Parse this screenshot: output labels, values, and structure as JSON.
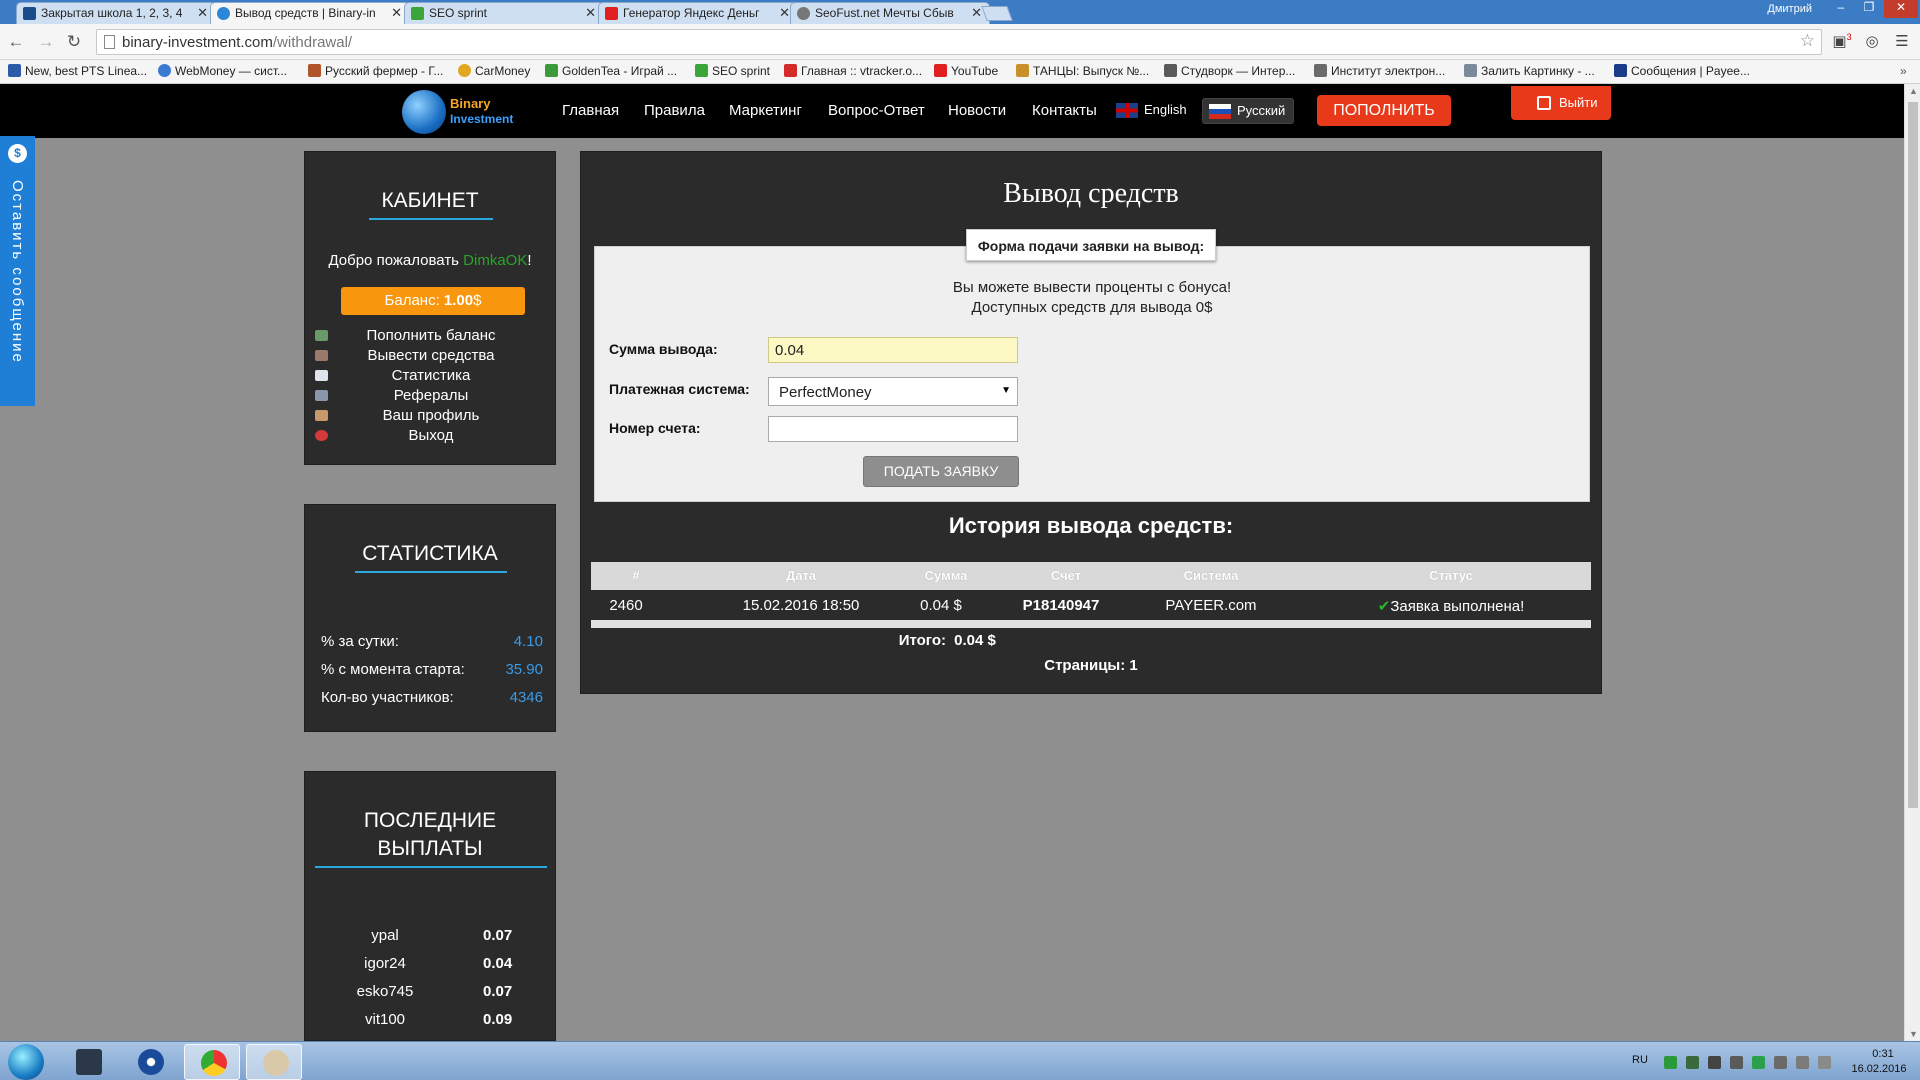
{
  "browser": {
    "tabs": [
      {
        "label": "Закрытая школа 1, 2, 3, 4"
      },
      {
        "label": "Вывод средств | Binary-in"
      },
      {
        "label": "SEO sprint"
      },
      {
        "label": "Генератор Яндекс Деньг"
      },
      {
        "label": "SeoFust.net Мечты Сбыв"
      }
    ],
    "user": "Дмитрий",
    "url_domain": "binary-investment.com",
    "url_path": "/withdrawal/",
    "bookmarks": [
      {
        "label": "New, best PTS Linea..."
      },
      {
        "label": "WebMoney — сист..."
      },
      {
        "label": "Русский фермер - Г..."
      },
      {
        "label": "CarMoney"
      },
      {
        "label": "GoldenTea - Играй ..."
      },
      {
        "label": "SEO sprint"
      },
      {
        "label": "Главная :: vtracker.o..."
      },
      {
        "label": "YouTube"
      },
      {
        "label": "ТАНЦЫ: Выпуск №..."
      },
      {
        "label": "Студворк — Интер..."
      },
      {
        "label": "Институт электрон..."
      },
      {
        "label": "Залить Картинку - ..."
      },
      {
        "label": "Сообщения | Payee..."
      }
    ],
    "extension_badge": "3"
  },
  "site": {
    "logo_line1": "Binary",
    "logo_line2": "Investment",
    "nav": [
      "Главная",
      "Правила",
      "Маркетинг",
      "Вопрос-Ответ",
      "Новости",
      "Контакты"
    ],
    "lang_en": "English",
    "lang_ru": "Русский",
    "topup_label": "ПОПОЛНИТЬ",
    "logout_label": "Выйти"
  },
  "feedback": {
    "label": "Оставить сообщение",
    "icon": "$"
  },
  "cabinet": {
    "title": "КАБИНЕТ",
    "welcome_prefix": "Добро пожаловать ",
    "username": "DimkaOK",
    "welcome_suffix": "!",
    "balance_label": "Баланс: ",
    "balance_value": "1.00",
    "balance_currency": "$",
    "menu": [
      {
        "label": "Пополнить баланс",
        "icon": "wallet-in-icon"
      },
      {
        "label": "Вывести средства",
        "icon": "wallet-out-icon"
      },
      {
        "label": "Статистика",
        "icon": "document-icon"
      },
      {
        "label": "Рефералы",
        "icon": "users-icon"
      },
      {
        "label": "Ваш профиль",
        "icon": "user-icon"
      },
      {
        "label": "Выход",
        "icon": "power-icon"
      }
    ]
  },
  "stats": {
    "title": "СТАТИСТИКА",
    "rows": [
      {
        "label": "% за сутки:",
        "value": "4.10"
      },
      {
        "label": "% с момента старта:",
        "value": "35.90"
      },
      {
        "label": "Кол-во участников:",
        "value": "4346"
      }
    ]
  },
  "payouts": {
    "title_line1": "ПОСЛЕДНИЕ",
    "title_line2": "ВЫПЛАТЫ",
    "rows": [
      {
        "name": "ypal",
        "value": "0.07"
      },
      {
        "name": "igor24",
        "value": "0.04"
      },
      {
        "name": "esko745",
        "value": "0.07"
      },
      {
        "name": "vit100",
        "value": "0.09"
      }
    ]
  },
  "withdraw": {
    "title": "Вывод средств",
    "form_legend": "Форма подачи заявки на вывод:",
    "info1": "Вы можете вывести проценты с бонуса!",
    "info2": "Доступных средств для вывода 0$",
    "amount_label": "Сумма вывода:",
    "amount_value": "0.04",
    "system_label": "Платежная система:",
    "system_value": "PerfectMoney",
    "account_label": "Номер счета:",
    "account_value": "",
    "submit_label": "ПОДАТЬ ЗАЯВКУ"
  },
  "history": {
    "title": "История вывода средств:",
    "columns": [
      "#",
      "Дата",
      "Сумма",
      "Счет",
      "Система",
      "Статус"
    ],
    "rows": [
      {
        "id": "2460",
        "date": "15.02.2016 18:50",
        "amount": "0.04 $",
        "account": "P18140947",
        "system": "PAYEER.com",
        "status": "Заявка выполнена!"
      }
    ],
    "total_label": "Итого:",
    "total_value": "0.04 $",
    "pages_label": "Страницы: ",
    "pages_value": "1"
  },
  "taskbar": {
    "lang": "RU",
    "time": "0:31",
    "date": "16.02.2016"
  },
  "colors": {
    "accent_orange": "#f8960e",
    "accent_red": "#e83a1a",
    "accent_blue": "#2ca8e0",
    "username_green": "#2aa52a",
    "panel_bg": "#2b2b2b",
    "page_bg": "#8f8f8f"
  }
}
